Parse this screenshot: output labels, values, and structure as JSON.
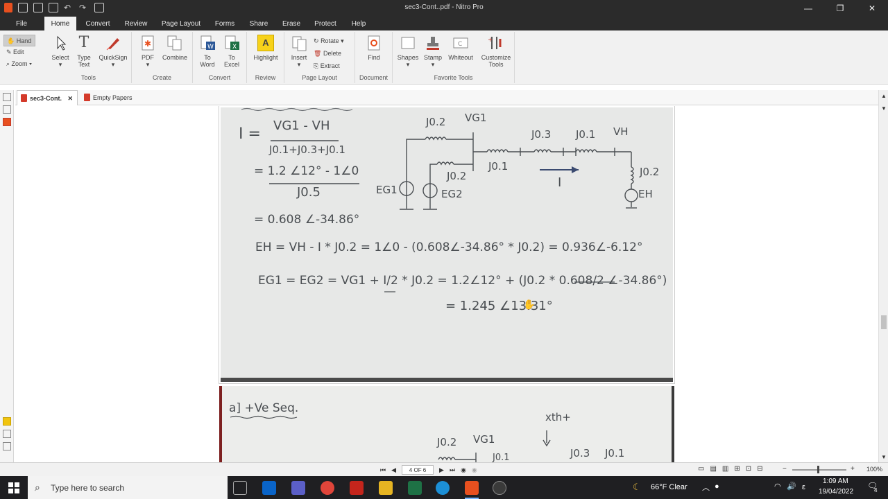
{
  "window": {
    "title": "sec3-Cont..pdf - Nitro Pro"
  },
  "menu": [
    "File",
    "Home",
    "Convert",
    "Review",
    "Page Layout",
    "Forms",
    "Share",
    "Erase",
    "Protect",
    "Help"
  ],
  "ribbon": {
    "hand": "Hand",
    "edit": "Edit",
    "zoom": "Zoom",
    "select": "Select",
    "type_text": "Type Text",
    "quicksign": "QuickSign",
    "tools_label": "Tools",
    "pdf": "PDF",
    "combine": "Combine",
    "create_label": "Create",
    "to_word": "To Word",
    "to_excel": "To Excel",
    "convert_label": "Convert",
    "highlight": "Highlight",
    "review_label": "Review",
    "insert": "Insert",
    "rotate": "Rotate",
    "delete": "Delete",
    "extract": "Extract",
    "page_layout_label": "Page Layout",
    "find": "Find",
    "document_label": "Document",
    "shapes": "Shapes",
    "stamp": "Stamp",
    "whiteout": "Whiteout",
    "customize_tools": "Customize Tools",
    "favorite_label": "Favorite Tools"
  },
  "tabs": [
    {
      "label": "sec3-Cont.",
      "active": true
    },
    {
      "label": "Empty Papers",
      "active": false
    }
  ],
  "page1": {
    "eq1_lhs": "I =",
    "eq1_num": "VG1 - VH",
    "eq1_den": "J0.1+J0.3+J0.1",
    "eq2_num": "= 1.2 ∠12° - 1∠0",
    "eq2_den": "J0.5",
    "eq3": "= 0.608 ∠-34.86°",
    "eq4": "EH = VH - I * J0.2 = 1∠0 - (0.608∠-34.86° * J0.2) = 0.936∠-6.12°",
    "eq5": "EG1 = EG2 = VG1 + I/2 * J0.2 = 1.2∠12° + (J0.2 * 0.608/2 ∠-34.86°)",
    "eq6": "= 1.245 ∠13.31°",
    "c_j02a": "J0.2",
    "c_vg1": "VG1",
    "c_j03": "J0.3",
    "c_j01a": "J0.1",
    "c_vh": "VH",
    "c_j02b": "J0.2",
    "c_j01b": "J0.1",
    "c_eg1": "EG1",
    "c_eg2": "EG2",
    "c_i": "I",
    "c_j02c": "J0.2",
    "c_eh": "EH"
  },
  "page2": {
    "heading": "a] +Ve Seq.",
    "c_j02": "J0.2",
    "c_vg1": "VG1",
    "c_xth": "xth+",
    "c_j01": "J0.1",
    "c_j03": "J0.3",
    "c_j01b": "J0.1"
  },
  "status": {
    "page": "4 OF 6",
    "zoom": "100%"
  },
  "taskbar": {
    "search_placeholder": "Type here to search",
    "weather": "66°F  Clear",
    "time": "1:09 AM",
    "date": "19/04/2022",
    "lang": "ε",
    "notif_count": "4"
  },
  "colors": {
    "ribbon_bg": "#f1f1f1",
    "title_bg": "#2b2b2b",
    "taskbar_bg": "#1f1f22",
    "ink": "#4a4e52"
  }
}
